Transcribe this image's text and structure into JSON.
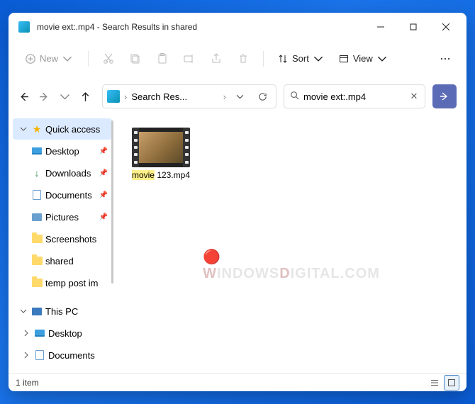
{
  "window": {
    "title": "movie ext:.mp4 - Search Results in shared"
  },
  "toolbar": {
    "new_label": "New",
    "sort_label": "Sort",
    "view_label": "View"
  },
  "breadcrumb": {
    "path_label": "Search Res..."
  },
  "search": {
    "query": "movie ext:.mp4"
  },
  "sidebar": {
    "quick_access": "Quick access",
    "items": [
      {
        "label": "Desktop",
        "pinned": true,
        "icon": "desktop"
      },
      {
        "label": "Downloads",
        "pinned": true,
        "icon": "down"
      },
      {
        "label": "Documents",
        "pinned": true,
        "icon": "doc"
      },
      {
        "label": "Pictures",
        "pinned": true,
        "icon": "pic"
      },
      {
        "label": "Screenshots",
        "pinned": false,
        "icon": "folder"
      },
      {
        "label": "shared",
        "pinned": false,
        "icon": "folder"
      },
      {
        "label": "temp post im",
        "pinned": false,
        "icon": "folder"
      }
    ],
    "this_pc": "This PC",
    "pc_items": [
      {
        "label": "Desktop",
        "icon": "desktop"
      },
      {
        "label": "Documents",
        "icon": "doc"
      }
    ]
  },
  "results": {
    "file_name_hl": "movie",
    "file_name_rest": " 123.mp4"
  },
  "status": {
    "count_text": "1 item"
  },
  "watermark": "WindowsDigital.com"
}
